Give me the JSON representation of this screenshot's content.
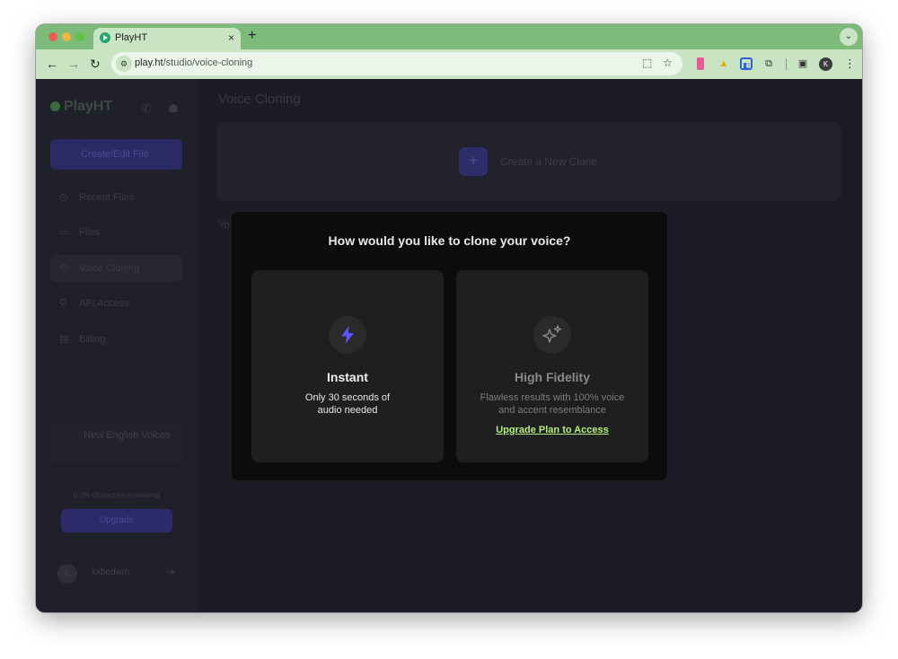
{
  "browser": {
    "tab_title": "PlayHT",
    "tab_close": "×",
    "new_tab": "+",
    "url_host": "play.ht",
    "url_path": "/studio/voice-cloning",
    "profile_initial": "K",
    "icons": [
      "back-icon",
      "forward-icon",
      "reload-icon",
      "site-info-icon",
      "install-app-icon",
      "bookmark-star-icon",
      "extensions-icon",
      "side-panel-icon",
      "kebab-menu-icon"
    ]
  },
  "sidebar": {
    "logo": "PlayHT",
    "create_button": "Create/Edit File",
    "items": [
      {
        "label": "Recent Files",
        "icon": "clock-icon"
      },
      {
        "label": "Files",
        "icon": "folder-icon"
      },
      {
        "label": "Voice Cloning",
        "icon": "voice-icon"
      },
      {
        "label": "API Access",
        "icon": "key-icon"
      },
      {
        "label": "Billing",
        "icon": "card-icon"
      }
    ],
    "promo": "New English Voices",
    "usage": "0.0% characters remaining",
    "upgrade_button": "Upgrade",
    "account_initial": "K",
    "account_name": "kxbedwm"
  },
  "main": {
    "title": "Voice Cloning",
    "create_clone": "Create a New Clone",
    "section_label": "Yo"
  },
  "modal": {
    "title": "How would you like to clone your voice?",
    "options": [
      {
        "title": "Instant",
        "description": "Only 30 seconds of audio needed",
        "icon": "lightning-icon"
      },
      {
        "title": "High Fidelity",
        "description": "Flawless results with 100% voice and accent resemblance",
        "icon": "sparkles-icon",
        "link": "Upgrade Plan to Access"
      }
    ]
  },
  "colors": {
    "browser_frame": "#7dbb7b",
    "toolbar": "#c8e4c3",
    "page_bg": "#1c1c26",
    "modal_bg": "#0c0c0c",
    "card_bg": "#1f1f1f",
    "accent_purple": "#5b53ff",
    "link_green": "#b5f07c"
  }
}
